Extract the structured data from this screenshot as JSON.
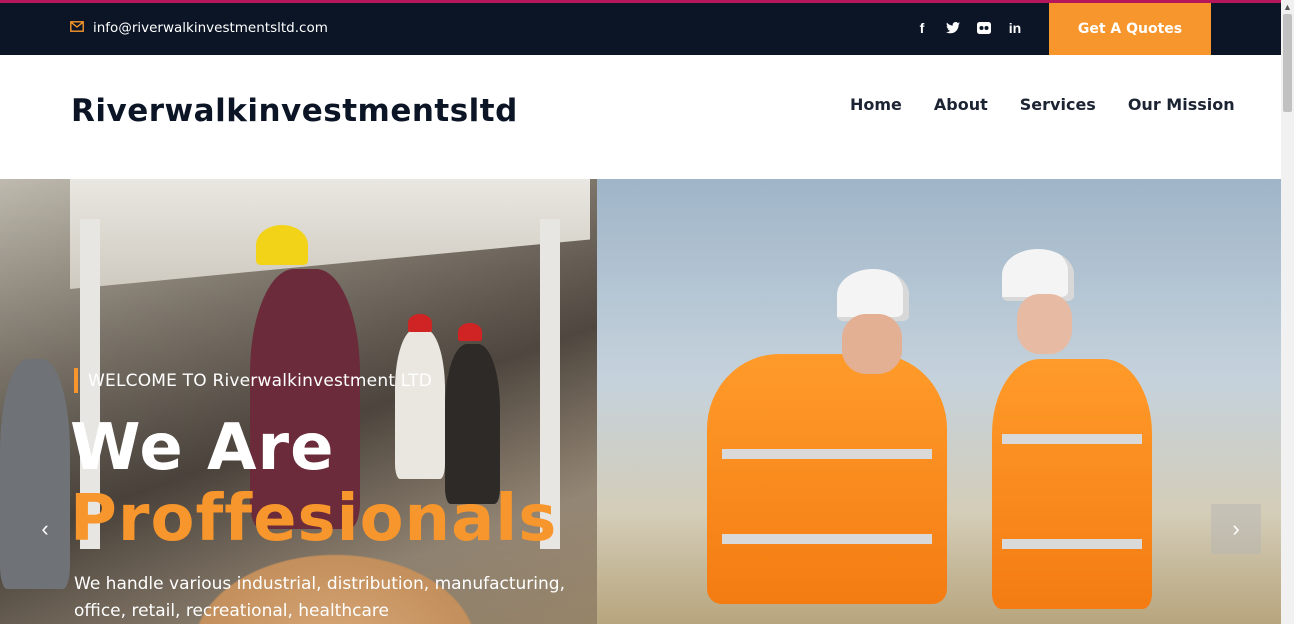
{
  "topbar": {
    "email": "info@riverwalkinvestmentsltd.com",
    "socials": [
      {
        "icon": "facebook-icon",
        "glyph": "f"
      },
      {
        "icon": "twitter-icon",
        "glyph": "𝕥"
      },
      {
        "icon": "flickr-icon",
        "glyph": "●●"
      },
      {
        "icon": "linkedin-icon",
        "glyph": "in"
      }
    ],
    "quote_button": "Get A Quotes"
  },
  "header": {
    "logo": "Riverwalkinvestmentsltd",
    "nav": [
      "Home",
      "About",
      "Services",
      "Our Mission"
    ]
  },
  "hero": {
    "welcome": "WELCOME TO Riverwalkinvestment LTD",
    "headline_line1": "We Are",
    "headline_line2": "Proffesionals",
    "description": "We handle various industrial, distribution, manufacturing, office, retail, recreational, healthcare",
    "prev_arrow": "‹",
    "next_arrow": "›"
  },
  "colors": {
    "accent": "#f7962c",
    "topbar_bg": "#0b1526",
    "top_line": "#b5175a"
  }
}
